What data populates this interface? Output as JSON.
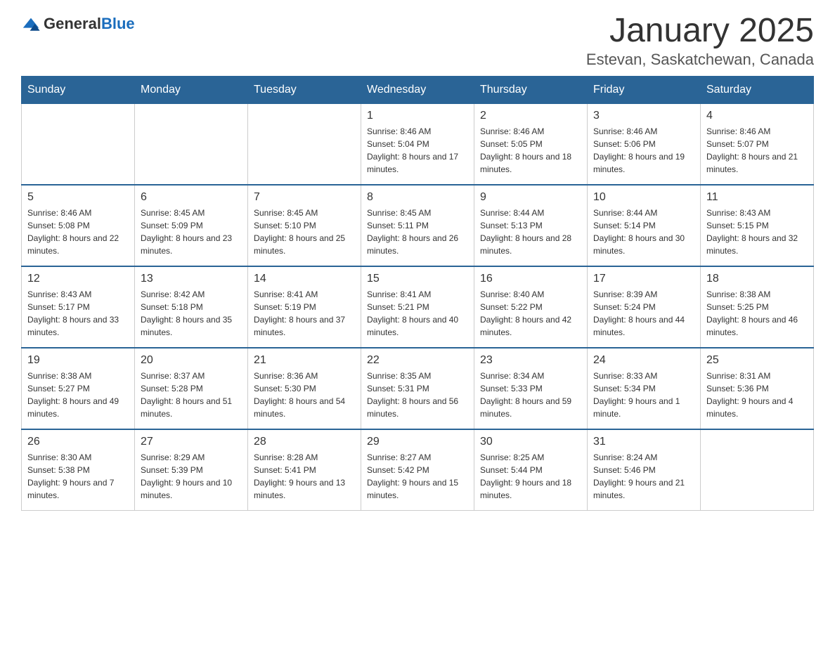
{
  "header": {
    "logo_general": "General",
    "logo_blue": "Blue",
    "month_title": "January 2025",
    "location": "Estevan, Saskatchewan, Canada"
  },
  "columns": [
    "Sunday",
    "Monday",
    "Tuesday",
    "Wednesday",
    "Thursday",
    "Friday",
    "Saturday"
  ],
  "weeks": [
    [
      {
        "day": "",
        "info": ""
      },
      {
        "day": "",
        "info": ""
      },
      {
        "day": "",
        "info": ""
      },
      {
        "day": "1",
        "info": "Sunrise: 8:46 AM\nSunset: 5:04 PM\nDaylight: 8 hours and 17 minutes."
      },
      {
        "day": "2",
        "info": "Sunrise: 8:46 AM\nSunset: 5:05 PM\nDaylight: 8 hours and 18 minutes."
      },
      {
        "day": "3",
        "info": "Sunrise: 8:46 AM\nSunset: 5:06 PM\nDaylight: 8 hours and 19 minutes."
      },
      {
        "day": "4",
        "info": "Sunrise: 8:46 AM\nSunset: 5:07 PM\nDaylight: 8 hours and 21 minutes."
      }
    ],
    [
      {
        "day": "5",
        "info": "Sunrise: 8:46 AM\nSunset: 5:08 PM\nDaylight: 8 hours and 22 minutes."
      },
      {
        "day": "6",
        "info": "Sunrise: 8:45 AM\nSunset: 5:09 PM\nDaylight: 8 hours and 23 minutes."
      },
      {
        "day": "7",
        "info": "Sunrise: 8:45 AM\nSunset: 5:10 PM\nDaylight: 8 hours and 25 minutes."
      },
      {
        "day": "8",
        "info": "Sunrise: 8:45 AM\nSunset: 5:11 PM\nDaylight: 8 hours and 26 minutes."
      },
      {
        "day": "9",
        "info": "Sunrise: 8:44 AM\nSunset: 5:13 PM\nDaylight: 8 hours and 28 minutes."
      },
      {
        "day": "10",
        "info": "Sunrise: 8:44 AM\nSunset: 5:14 PM\nDaylight: 8 hours and 30 minutes."
      },
      {
        "day": "11",
        "info": "Sunrise: 8:43 AM\nSunset: 5:15 PM\nDaylight: 8 hours and 32 minutes."
      }
    ],
    [
      {
        "day": "12",
        "info": "Sunrise: 8:43 AM\nSunset: 5:17 PM\nDaylight: 8 hours and 33 minutes."
      },
      {
        "day": "13",
        "info": "Sunrise: 8:42 AM\nSunset: 5:18 PM\nDaylight: 8 hours and 35 minutes."
      },
      {
        "day": "14",
        "info": "Sunrise: 8:41 AM\nSunset: 5:19 PM\nDaylight: 8 hours and 37 minutes."
      },
      {
        "day": "15",
        "info": "Sunrise: 8:41 AM\nSunset: 5:21 PM\nDaylight: 8 hours and 40 minutes."
      },
      {
        "day": "16",
        "info": "Sunrise: 8:40 AM\nSunset: 5:22 PM\nDaylight: 8 hours and 42 minutes."
      },
      {
        "day": "17",
        "info": "Sunrise: 8:39 AM\nSunset: 5:24 PM\nDaylight: 8 hours and 44 minutes."
      },
      {
        "day": "18",
        "info": "Sunrise: 8:38 AM\nSunset: 5:25 PM\nDaylight: 8 hours and 46 minutes."
      }
    ],
    [
      {
        "day": "19",
        "info": "Sunrise: 8:38 AM\nSunset: 5:27 PM\nDaylight: 8 hours and 49 minutes."
      },
      {
        "day": "20",
        "info": "Sunrise: 8:37 AM\nSunset: 5:28 PM\nDaylight: 8 hours and 51 minutes."
      },
      {
        "day": "21",
        "info": "Sunrise: 8:36 AM\nSunset: 5:30 PM\nDaylight: 8 hours and 54 minutes."
      },
      {
        "day": "22",
        "info": "Sunrise: 8:35 AM\nSunset: 5:31 PM\nDaylight: 8 hours and 56 minutes."
      },
      {
        "day": "23",
        "info": "Sunrise: 8:34 AM\nSunset: 5:33 PM\nDaylight: 8 hours and 59 minutes."
      },
      {
        "day": "24",
        "info": "Sunrise: 8:33 AM\nSunset: 5:34 PM\nDaylight: 9 hours and 1 minute."
      },
      {
        "day": "25",
        "info": "Sunrise: 8:31 AM\nSunset: 5:36 PM\nDaylight: 9 hours and 4 minutes."
      }
    ],
    [
      {
        "day": "26",
        "info": "Sunrise: 8:30 AM\nSunset: 5:38 PM\nDaylight: 9 hours and 7 minutes."
      },
      {
        "day": "27",
        "info": "Sunrise: 8:29 AM\nSunset: 5:39 PM\nDaylight: 9 hours and 10 minutes."
      },
      {
        "day": "28",
        "info": "Sunrise: 8:28 AM\nSunset: 5:41 PM\nDaylight: 9 hours and 13 minutes."
      },
      {
        "day": "29",
        "info": "Sunrise: 8:27 AM\nSunset: 5:42 PM\nDaylight: 9 hours and 15 minutes."
      },
      {
        "day": "30",
        "info": "Sunrise: 8:25 AM\nSunset: 5:44 PM\nDaylight: 9 hours and 18 minutes."
      },
      {
        "day": "31",
        "info": "Sunrise: 8:24 AM\nSunset: 5:46 PM\nDaylight: 9 hours and 21 minutes."
      },
      {
        "day": "",
        "info": ""
      }
    ]
  ]
}
